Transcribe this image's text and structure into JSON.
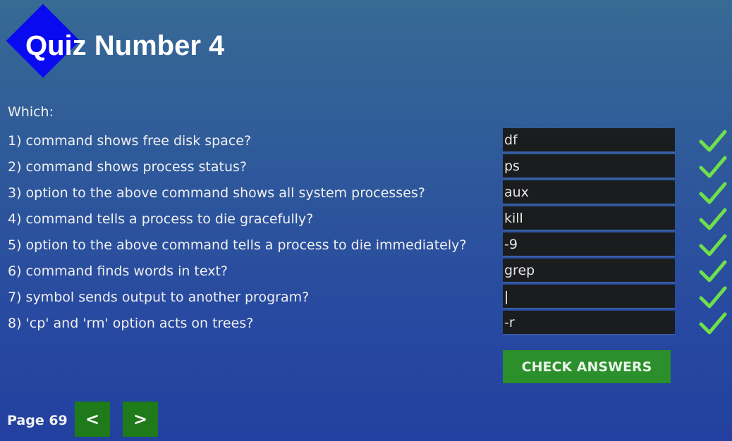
{
  "header": {
    "title": "Quiz Number 4",
    "logo_color": "#0a0af0"
  },
  "intro": "Which:",
  "questions": [
    {
      "text": "1) command shows free disk space?",
      "answer": "df",
      "status": "correct"
    },
    {
      "text": "2) command shows process status?",
      "answer": "ps",
      "status": "correct"
    },
    {
      "text": "3) option to the above command shows all system processes?",
      "answer": "aux",
      "status": "correct"
    },
    {
      "text": "4) command tells a process to die gracefully?",
      "answer": "kill",
      "status": "correct"
    },
    {
      "text": "5) option to the above command tells a process to die immediately?",
      "answer": "-9",
      "status": "correct"
    },
    {
      "text": "6) command finds words in text?",
      "answer": "grep",
      "status": "correct"
    },
    {
      "text": "7) symbol sends output to another program?",
      "answer": "|",
      "status": "correct"
    },
    {
      "text": "8) 'cp' and 'rm' option acts on trees?",
      "answer": "-r",
      "status": "correct"
    }
  ],
  "check_button": {
    "label": "CHECK ANSWERS",
    "color": "#2b8f2b"
  },
  "pagination": {
    "label": "Page 69",
    "prev_label": "<",
    "next_label": ">",
    "button_color": "#1f7a1a"
  },
  "colors": {
    "correct_check": "#6fe04a",
    "input_bg": "#1b1c1e"
  }
}
